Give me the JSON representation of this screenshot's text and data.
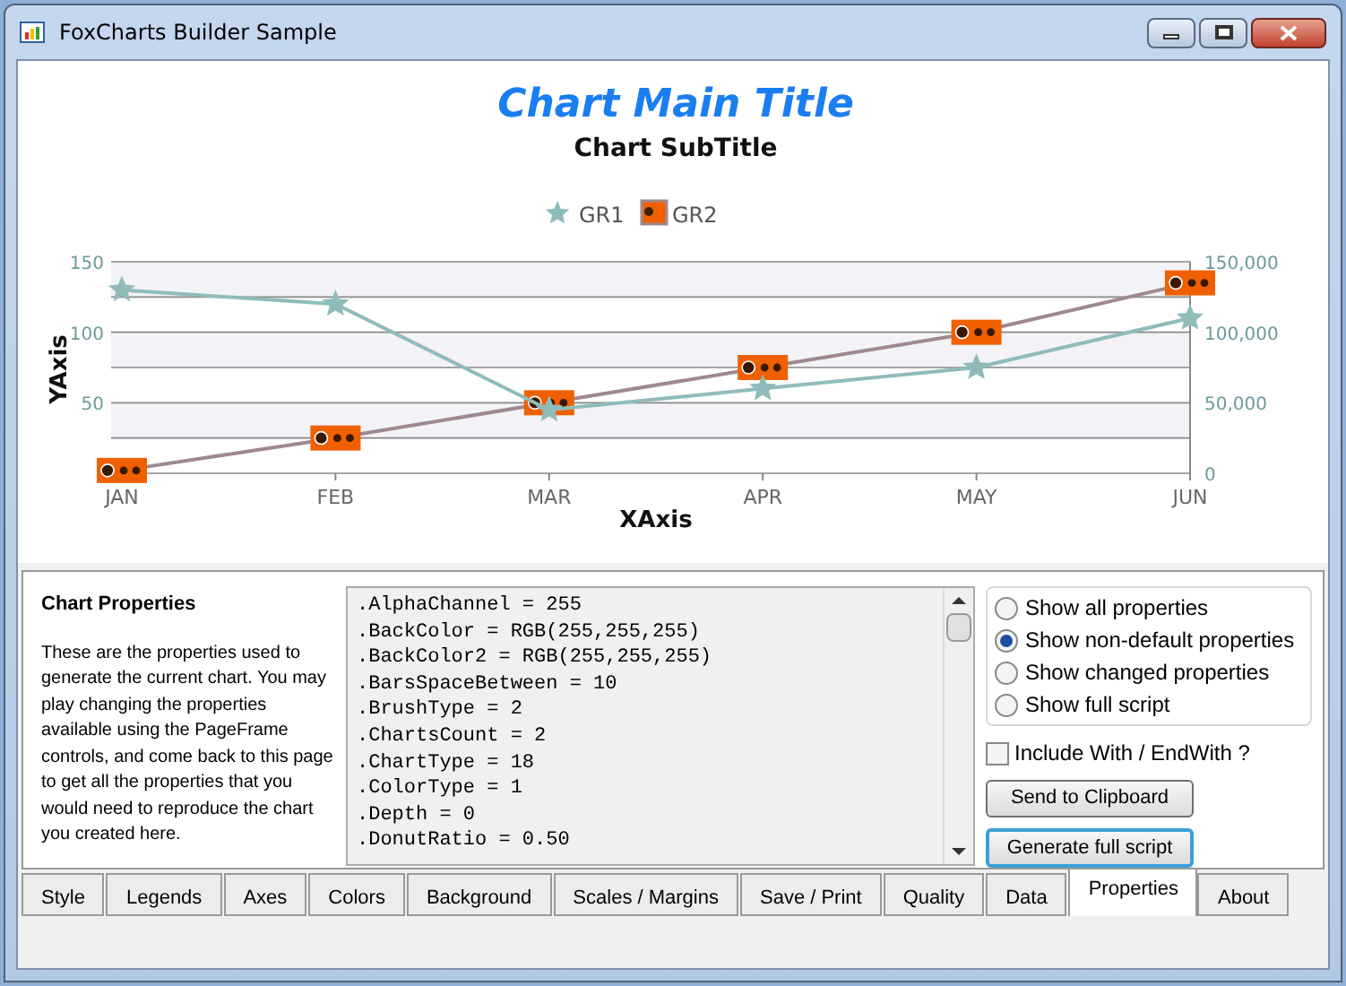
{
  "window": {
    "title": "FoxCharts Builder Sample"
  },
  "chart": {
    "chart_data": {
      "type": "line",
      "title": "Chart Main Title",
      "subtitle": "Chart SubTitle",
      "xlabel": "XAxis",
      "ylabel": "YAxis",
      "categories": [
        "JAN",
        "FEB",
        "MAR",
        "APR",
        "MAY",
        "JUN"
      ],
      "ylim": [
        0,
        150
      ],
      "yticks": [
        50,
        100,
        150
      ],
      "y2ticks": [
        {
          "value": 0,
          "label": "0"
        },
        {
          "value": 50000,
          "label": "50,000"
        },
        {
          "value": 100000,
          "label": "100,000"
        },
        {
          "value": 150000,
          "label": "150,000"
        }
      ],
      "series": [
        {
          "name": "GR1",
          "color": "#8fbcbb",
          "marker": "star",
          "values": [
            130,
            120,
            45,
            60,
            75,
            110
          ]
        },
        {
          "name": "GR2",
          "color": "#a08890",
          "marker": "square",
          "axis": "y2",
          "values": [
            2000,
            25000,
            50000,
            75000,
            100000,
            135000
          ]
        }
      ],
      "y2lim": [
        0,
        150000
      ],
      "legend": "top",
      "bands": [
        {
          "axis": "y",
          "from": 25,
          "to": 50,
          "color": "#f3f3f7"
        },
        {
          "axis": "y",
          "from": 75,
          "to": 100,
          "color": "#f3f3f7"
        },
        {
          "axis": "y",
          "from": 125,
          "to": 150,
          "color": "#f3f3f7"
        }
      ]
    }
  },
  "properties": {
    "title": "Chart Properties",
    "description": "These are the properties used to generate the current chart. You may play changing the properties available using the PageFrame controls, and come back to this page to get all the properties that you would need to reproduce the chart you created here.",
    "script_lines": [
      ".AlphaChannel = 255",
      ".BackColor = RGB(255,255,255)",
      ".BackColor2 = RGB(255,255,255)",
      ".BarsSpaceBetween = 10",
      ".BrushType = 2",
      ".ChartsCount = 2",
      ".ChartType = 18",
      ".ColorType = 1",
      ".Depth = 0",
      ".DonutRatio = 0.50"
    ],
    "options": [
      {
        "label": "Show all properties",
        "selected": false
      },
      {
        "label": "Show non-default properties",
        "selected": true
      },
      {
        "label": "Show changed properties",
        "selected": false
      },
      {
        "label": "Show full script",
        "selected": false
      }
    ],
    "include_with": {
      "label": "Include With / EndWith ?",
      "checked": false
    },
    "buttons": [
      {
        "label": "Send to Clipboard",
        "focused": false
      },
      {
        "label": "Generate full script",
        "focused": true
      }
    ]
  },
  "tabs": [
    {
      "label": "Style",
      "selected": false
    },
    {
      "label": "Legends",
      "selected": false
    },
    {
      "label": "Axes",
      "selected": false
    },
    {
      "label": "Colors",
      "selected": false
    },
    {
      "label": "Background",
      "selected": false
    },
    {
      "label": "Scales / Margins",
      "selected": false
    },
    {
      "label": "Save / Print",
      "selected": false
    },
    {
      "label": "Quality",
      "selected": false
    },
    {
      "label": "Data",
      "selected": false
    },
    {
      "label": "Properties",
      "selected": true
    },
    {
      "label": "About",
      "selected": false
    }
  ]
}
